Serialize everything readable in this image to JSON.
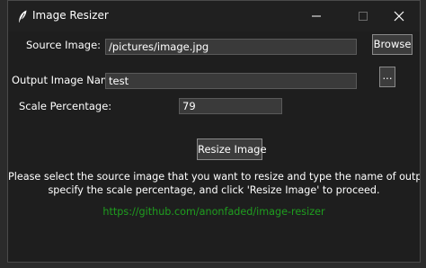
{
  "window": {
    "title": "Image Resizer",
    "app_icon": "feather-icon"
  },
  "controls": {
    "minimize_icon": "minimize-icon",
    "maximize_icon": "maximize-icon",
    "close_icon": "close-icon"
  },
  "form": {
    "source_label": "Source Image:",
    "source_value": "/pictures/image.jpg",
    "browse_label": "Browse",
    "output_label": "Output Image Name:",
    "output_value": "test",
    "output_browse_label": "...",
    "scale_label": "Scale Percentage:",
    "scale_value": "79",
    "resize_label": "Resize Image"
  },
  "info": {
    "line1": "Please select the source image that you want to resize and type the name of output image,",
    "line2": "specify the scale percentage, and click 'Resize Image' to proceed.",
    "link": "https://github.com/anonfaded/image-resizer"
  },
  "colors": {
    "window_bg": "#1e1e1e",
    "titlebar_bg": "#202020",
    "entry_bg": "#3a3a3a",
    "link": "#1f9e1f"
  }
}
